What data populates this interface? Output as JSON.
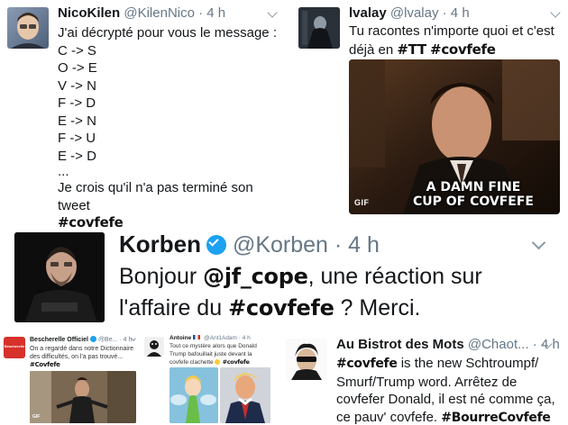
{
  "t1": {
    "name": "NicoKilen",
    "handle": "@KilenNico",
    "time": "· 4 h",
    "line0": "J'ai décrypté pour vous le message :",
    "lines": [
      "C -> S",
      "O -> E",
      "V -> N",
      "F -> D",
      "E -> N",
      "F -> U",
      "E -> D",
      "..."
    ],
    "line_end1": "Je crois qu'il n'a pas terminé son",
    "line_end2": "tweet",
    "hashtag": "#covfefe"
  },
  "t2": {
    "name": "lvalay",
    "handle": "@lvalay",
    "time": "· 4 h",
    "line1": "Tu racontes n'importe quoi et c'est",
    "line2_pre": "déjà en",
    "tag_tt": "#TT",
    "tag_covfefe": "#covfefe",
    "gif_caption_1": "A DAMN FINE",
    "gif_caption_2": "CUP OF COVFEFE",
    "gif_badge": "GIF"
  },
  "t3": {
    "name": "Korben",
    "handle": "@Korben",
    "time": "· 4 h",
    "text_pre": "Bonjour",
    "mention": "@jf_cope",
    "text_mid": ", une réaction sur",
    "text_line2_pre": "l'affaire du",
    "hashtag": "#covfefe",
    "text_end": "? Merci."
  },
  "t4": {
    "name": "Bescherelle Officiel",
    "handle": "@Be...",
    "time": "· 4 h",
    "line1": "On a regardé dans notre Dictionnaire",
    "line2": "des difficultés, on l'a pas trouvé...",
    "hashtag": "#Covfefe",
    "avatar_text": "Bescherelle",
    "gif_badge": "GIF"
  },
  "t5": {
    "name": "Antoine",
    "handle": "@Ant1Adam",
    "time": "· 4 h",
    "line1": "Tout ce mystère alors que Donald",
    "line2": "Trump bafouillait juste devant la",
    "line3_pre": "covfefe clachette",
    "hashtag": "#covfefe"
  },
  "t6": {
    "name": "Au Bistrot des Mots",
    "handle": "@Chaot...",
    "time": "· 4 h",
    "tag_covfefe": "#covfefe",
    "line1_rest": "is the new Schtroumpf/",
    "line2": "Smurf/Trump word. Arrêtez de",
    "line3": "covfefer Donald, il est né comme ça,",
    "line4_pre": "ce pauv' covfefe.",
    "tag_bourre": "#BourreCovfefe"
  },
  "colors": {
    "text": "#14171a",
    "secondary": "#657786",
    "verified": "#1da1f2",
    "divider": "#e1e8ed"
  }
}
